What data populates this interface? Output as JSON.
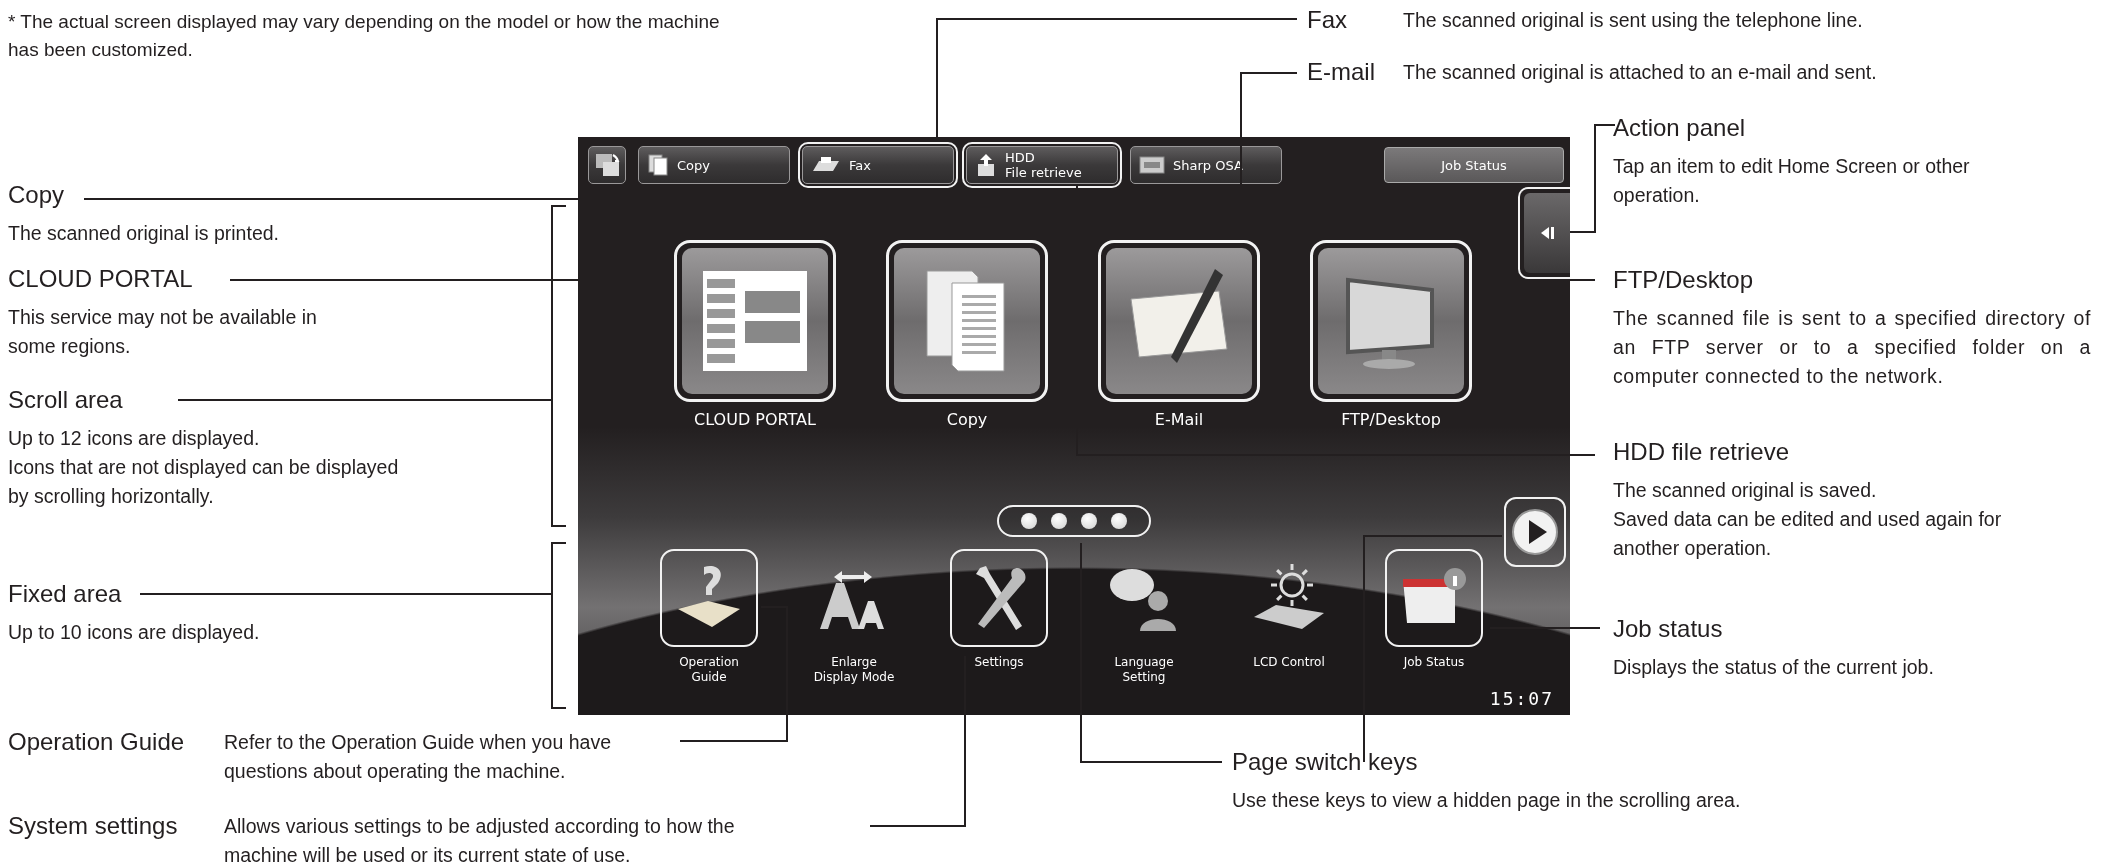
{
  "note": "* The actual screen displayed may vary depending on the model or how the machine\nhas been customized.",
  "callouts": [
    {
      "title": "Fax",
      "text": "The scanned original is sent using the telephone line."
    },
    {
      "title": "E-mail",
      "text": "The scanned original is attached to an e-mail and sent."
    },
    {
      "title": "Action panel",
      "text": "Tap an item to edit Home Screen or other\noperation."
    },
    {
      "title": "Copy",
      "text": "The scanned original is printed."
    },
    {
      "title": "CLOUD PORTAL",
      "text": "This service may not be available in\nsome regions."
    },
    {
      "title": "Scroll area",
      "text": "Up to 12 icons are displayed.\nIcons that are not displayed can be displayed\nby scrolling horizontally."
    },
    {
      "title": "Fixed area",
      "text": "Up to 10 icons are displayed."
    },
    {
      "title": "FTP/Desktop",
      "text": "The scanned file is sent to a specified directory of an FTP server or to a specified folder on a computer connected to the network."
    },
    {
      "title": "HDD file retrieve",
      "text": "The scanned original is saved.\nSaved data can be edited and used again for\nanother operation."
    },
    {
      "title": "Job status",
      "text": "Displays the status of the current job."
    },
    {
      "title": "Operation Guide",
      "text": "Refer to the Operation Guide when you have\nquestions about operating the machine."
    },
    {
      "title": "System settings",
      "text": "Allows various settings to be adjusted according to how the\nmachine will be used or its current state of use."
    },
    {
      "title": "Page switch keys",
      "text": "Use these keys to view a hidden page in the scrolling area."
    }
  ],
  "screen": {
    "top_bar": [
      {
        "label": "Copy",
        "highlighted": false
      },
      {
        "label": "Fax",
        "highlighted": true
      },
      {
        "label": "HDD\nFile retrieve",
        "highlighted": true
      },
      {
        "label": "Sharp OSA",
        "highlighted": false
      }
    ],
    "job_status_button": "Job Status",
    "action_panel": {
      "highlighted": true
    },
    "apps": [
      {
        "label": "CLOUD PORTAL",
        "highlighted": true
      },
      {
        "label": "Copy",
        "highlighted": true
      },
      {
        "label": "E-Mail",
        "highlighted": true
      },
      {
        "label": "FTP/Desktop",
        "highlighted": true
      }
    ],
    "page_keys": {
      "highlighted": true
    },
    "next_button": {
      "highlighted": true
    },
    "fixed": [
      {
        "label": "Operation\nGuide",
        "highlighted": true
      },
      {
        "label": "Enlarge\nDisplay Mode",
        "highlighted": false
      },
      {
        "label": "Settings",
        "highlighted": true
      },
      {
        "label": "Language\nSetting",
        "highlighted": false
      },
      {
        "label": "LCD Control",
        "highlighted": false
      },
      {
        "label": "Job Status",
        "highlighted": true
      }
    ],
    "clock": "15:07"
  }
}
